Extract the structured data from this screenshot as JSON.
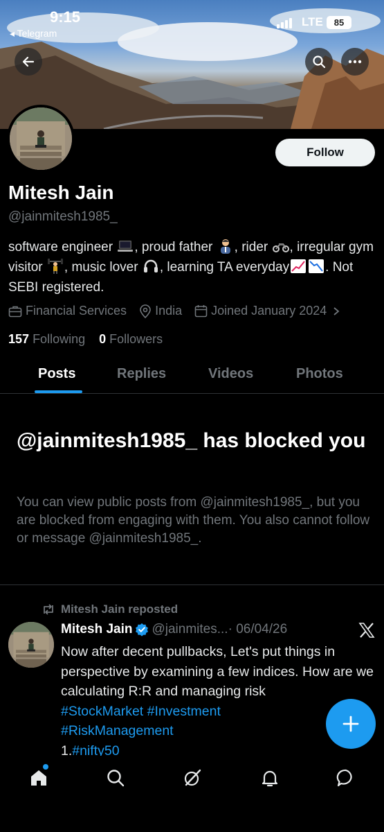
{
  "status_bar": {
    "time": "9:15",
    "back_app": "◂ Telegram",
    "network": "LTE",
    "battery": "85"
  },
  "profile": {
    "name": "Mitesh Jain",
    "handle": "@jainmitesh1985_",
    "follow_label": "Follow",
    "bio": {
      "part1": "software engineer",
      "part2": ", proud father",
      "part3": ", rider",
      "part4": ",",
      "part5": "irregular gym visitor",
      "part6": ", music lover",
      "part7": ", learning TA",
      "part8": "everyday",
      "part9": ". Not SEBI registered."
    },
    "category": "Financial Services",
    "location": "India",
    "joined": "Joined January 2024",
    "following_count": "157",
    "following_label": "Following",
    "followers_count": "0",
    "followers_label": "Followers"
  },
  "tabs": [
    {
      "label": "Posts"
    },
    {
      "label": "Replies"
    },
    {
      "label": "Videos"
    },
    {
      "label": "Photos"
    }
  ],
  "blocked": {
    "title": "@jainmitesh1985_ has blocked you",
    "message": "You can view public posts from @jainmitesh1985_, but you are blocked from engaging with them. You also cannot follow or message @jainmitesh1985_."
  },
  "post": {
    "repost_label": "Mitesh Jain reposted",
    "author": "Mitesh Jain",
    "handle": "@jainmites...",
    "date": "· 06/04/26",
    "text": "Now after decent pullbacks, Let's put things in perspective by examining a few indices. How are we calculating R:R and managing risk",
    "tag1": "#StockMarket",
    "tag2": "#Investment",
    "tag3": "#RiskManagement",
    "line_prefix": "1.",
    "tag4": "#nifty50"
  },
  "colors": {
    "accent": "#1d9bf0",
    "background": "#000000",
    "muted": "#71767b"
  },
  "icons": [
    "back-arrow-icon",
    "search-icon",
    "more-icon",
    "briefcase-icon",
    "location-icon",
    "calendar-icon",
    "chevron-right-icon",
    "repost-icon",
    "verified-icon",
    "x-logo-icon",
    "plus-icon",
    "home-icon",
    "explore-icon",
    "grok-icon",
    "notifications-icon",
    "messages-icon"
  ]
}
